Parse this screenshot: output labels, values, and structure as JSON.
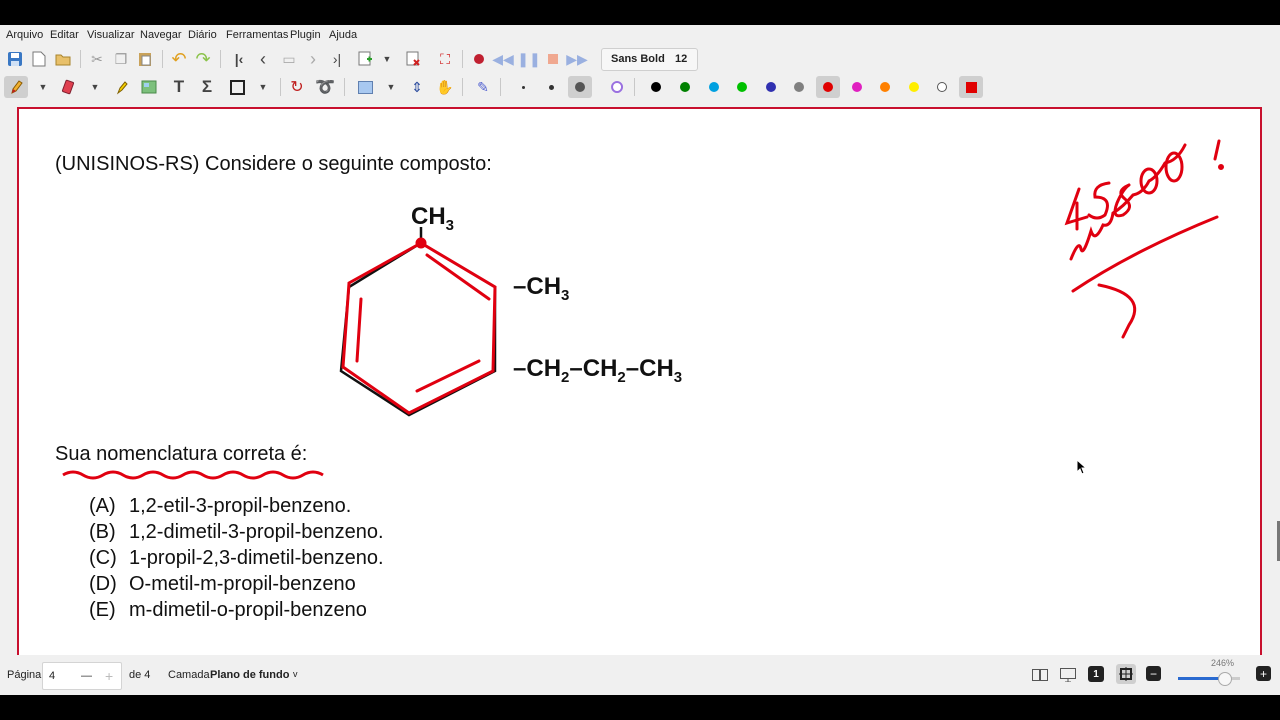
{
  "menu": [
    "Arquivo",
    "Editar",
    "Visualizar",
    "Navegar",
    "Diário",
    "Ferramentas",
    "Plugin",
    "Ajuda"
  ],
  "toolbar": {
    "font_name": "Sans Bold",
    "font_size": "12"
  },
  "palette": {
    "colors": [
      "#000000",
      "#008000",
      "#00a0e0",
      "#00c000",
      "#3030b0",
      "#808080",
      "#e00000",
      "#e020c0",
      "#ff8000",
      "#ffee00",
      "#ffffff"
    ],
    "selected_color": "#e00000",
    "current_color": "#e00000"
  },
  "document": {
    "question": "(UNISINOS-RS) Considere o seguinte composto:",
    "prompt": "Sua nomenclatura correta é:",
    "options": [
      {
        "letter": "(A)",
        "text": "1,2-etil-3-propil-benzeno."
      },
      {
        "letter": "(B)",
        "text": "1,2-dimetil-3-propil-benzeno."
      },
      {
        "letter": "(C)",
        "text": "1-propil-2,3-dimetil-benzeno."
      },
      {
        "letter": "(D)",
        "text": "O-metil-m-propil-benzeno"
      },
      {
        "letter": "(E)",
        "text": "m-dimetil-o-propil-benzeno"
      }
    ],
    "structure": {
      "top_group": "CH",
      "top_sub": "3",
      "mid_group": "CH",
      "mid_sub": "3",
      "chain": [
        {
          "g": "CH",
          "s": "2"
        },
        {
          "g": "CH",
          "s": "2"
        },
        {
          "g": "CH",
          "s": "3"
        }
      ]
    }
  },
  "status": {
    "page_label": "Página",
    "page_value": "4",
    "minus": "—",
    "plus": "+",
    "of_pages": "de 4",
    "layer_label": "Camada",
    "layer_value": "Plano de fundo",
    "zoom": "246%"
  }
}
